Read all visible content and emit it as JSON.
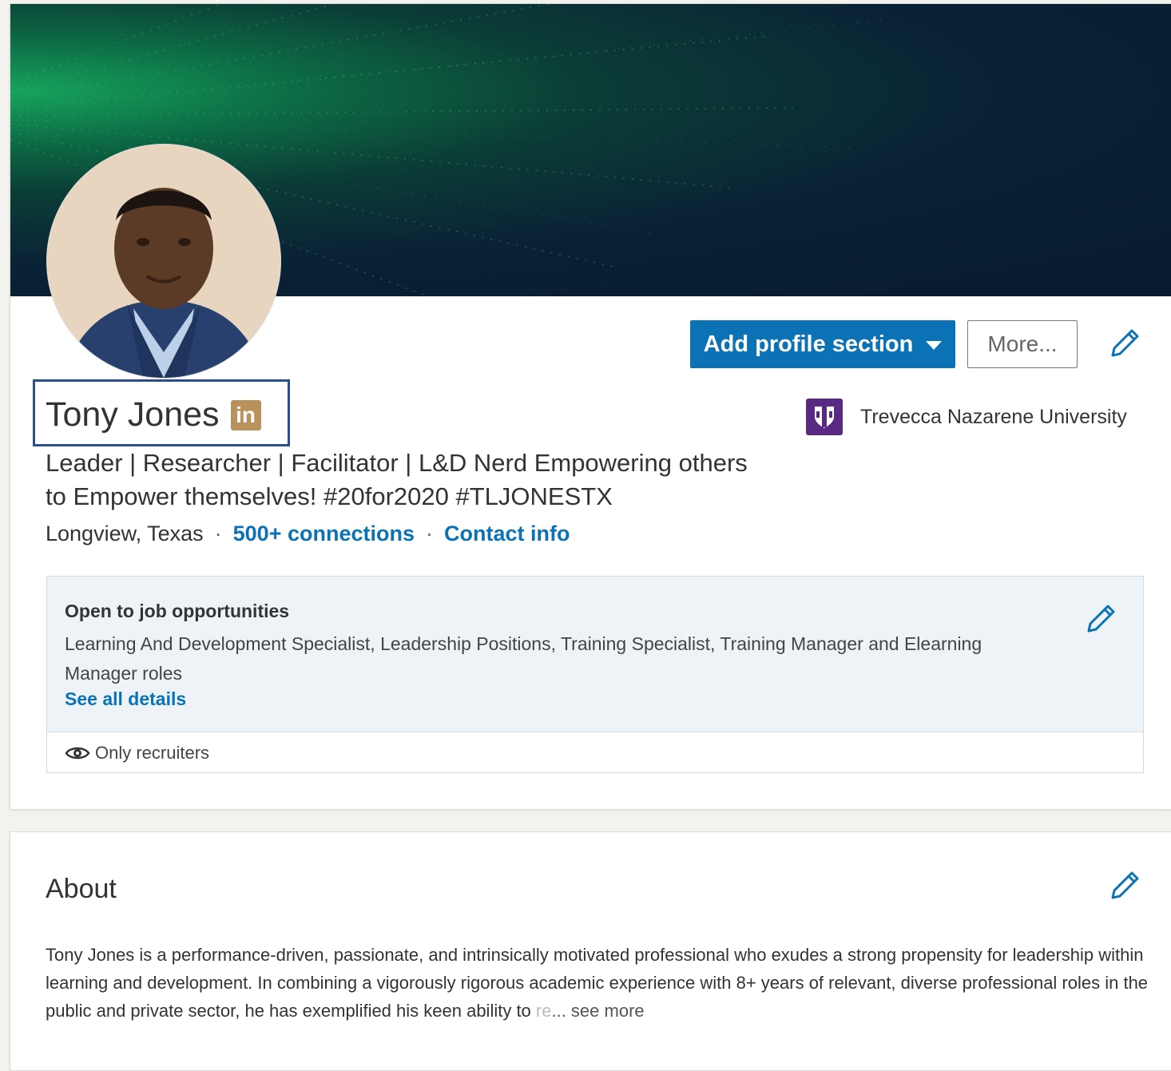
{
  "profile": {
    "name": "Tony Jones",
    "badge_text": "in",
    "headline": "Leader | Researcher | Facilitator | L&D Nerd Empowering others to Empower themselves! #20for2020 #TLJONESTX",
    "location": "Longview, Texas",
    "connections_link": "500+ connections",
    "contact_link": "Contact info",
    "separator": "·",
    "school": "Trevecca Nazarene University"
  },
  "actions": {
    "add_section_label": "Add profile section",
    "more_label": "More..."
  },
  "open_to_work": {
    "title": "Open to job opportunities",
    "description": "Learning And Development Specialist, Leadership Positions, Training Specialist, Training Manager and Elearning Manager roles",
    "details_link": "See all details",
    "visibility": "Only recruiters"
  },
  "about": {
    "title": "About",
    "text": "Tony Jones is a performance-driven, passionate, and intrinsically motivated professional who exudes a strong propensity for leadership within learning and development. In combining a vigorously rigorous academic experience with 8+ years of relevant, diverse professional roles in the public and private sector, he has exemplified his keen ability to ",
    "faded_tail": "re",
    "see_more": "... see more"
  },
  "icons": {
    "edit": "pencil-icon",
    "visibility": "eye-icon",
    "dropdown": "caret-down-icon",
    "school_logo": "shield-icon"
  },
  "colors": {
    "primary": "#0b73b5",
    "badge": "#b8925a",
    "school": "#5a2a82",
    "highlight_box": "#2d4e8c"
  }
}
